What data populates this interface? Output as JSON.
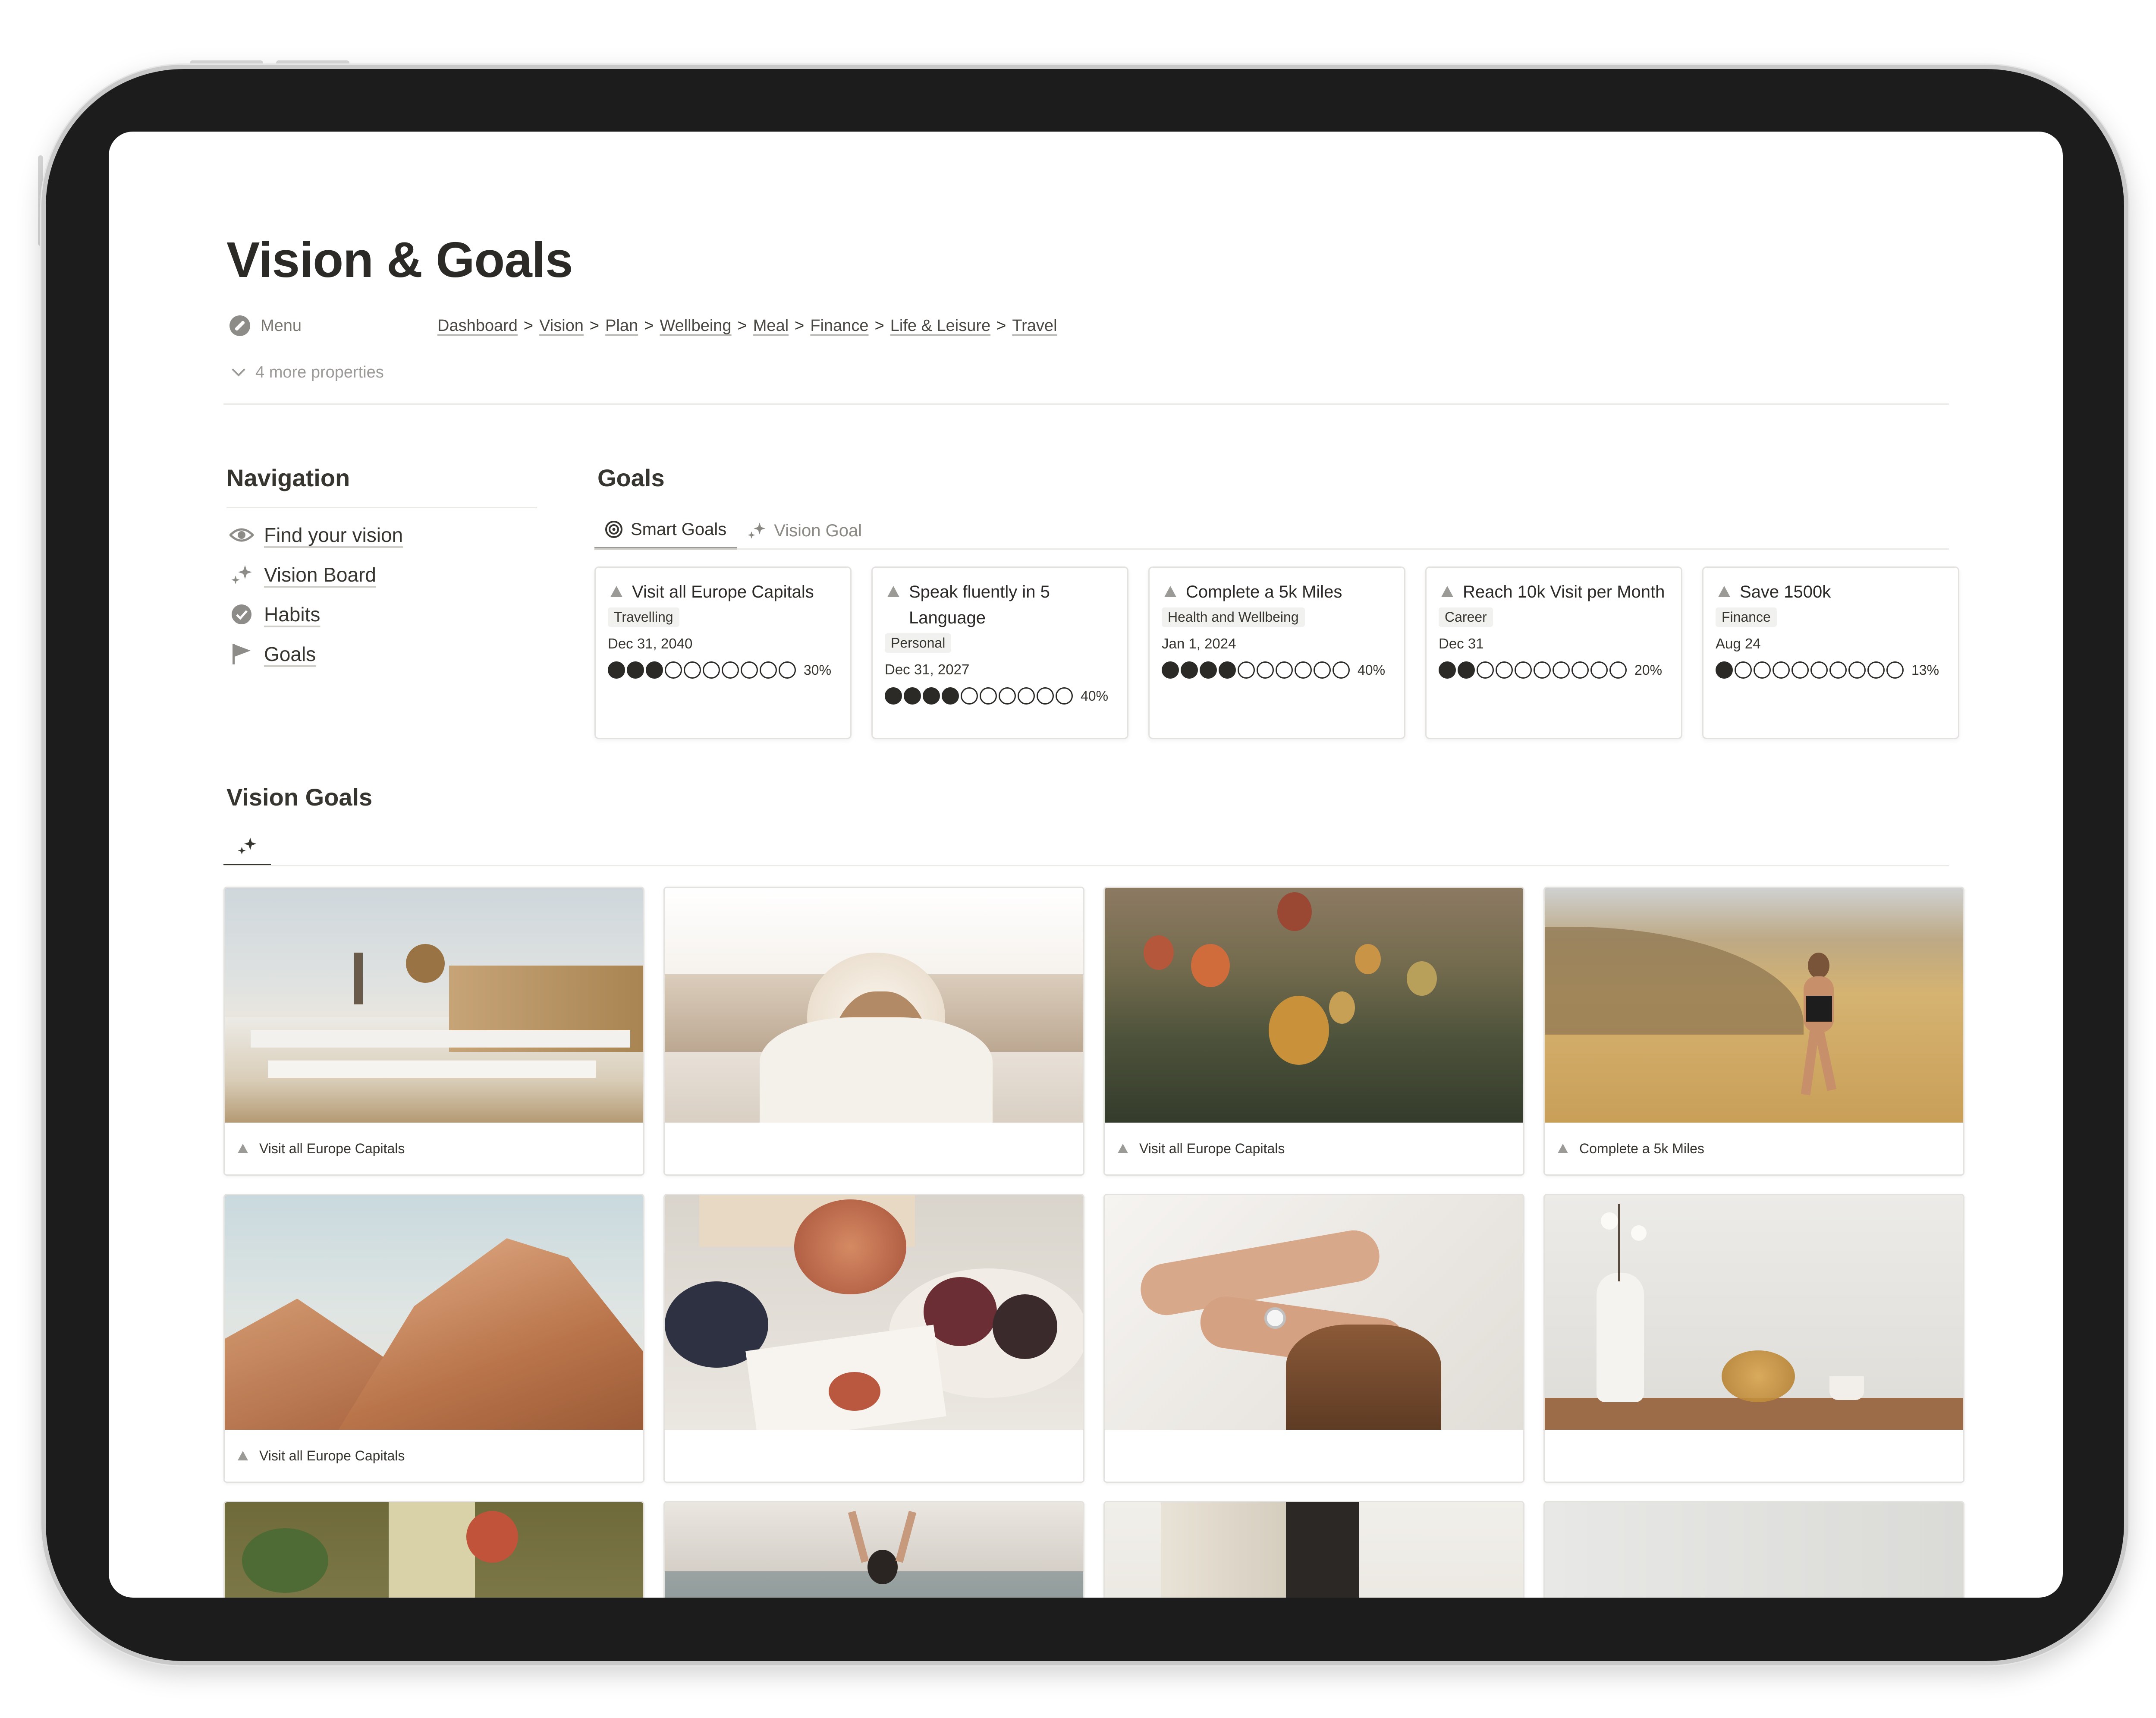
{
  "page": {
    "title": "Vision & Goals",
    "menu_label": "Menu",
    "breadcrumbs": [
      "Dashboard",
      "Vision",
      "Plan",
      "Wellbeing",
      "Meal",
      "Finance",
      "Life & Leisure",
      "Travel"
    ],
    "breadcrumb_separator": ">",
    "more_properties": "4 more properties"
  },
  "navigation": {
    "title": "Navigation",
    "items": [
      {
        "label": "Find your vision",
        "icon": "eye-icon"
      },
      {
        "label": "Vision Board",
        "icon": "sparkles-icon"
      },
      {
        "label": "Habits",
        "icon": "check-circle-icon"
      },
      {
        "label": "Goals",
        "icon": "flag-icon"
      }
    ]
  },
  "goals": {
    "title": "Goals",
    "tabs": [
      {
        "label": "Smart Goals",
        "icon": "target-icon",
        "active": true
      },
      {
        "label": "Vision Goal",
        "icon": "sparkles-icon",
        "active": false
      }
    ],
    "cards": [
      {
        "title": "Visit all Europe Capitals",
        "tag": "Travelling",
        "date": "Dec 31, 2040",
        "progress": 0.3,
        "filled": 3,
        "percent": "30%"
      },
      {
        "title": "Speak fluently in 5 Language",
        "tag": "Personal",
        "date": "Dec 31, 2027",
        "progress": 0.4,
        "filled": 4,
        "percent": "40%"
      },
      {
        "title": "Complete a 5k Miles",
        "tag": "Health and Wellbeing",
        "date": "Jan 1, 2024",
        "progress": 0.4,
        "filled": 4,
        "percent": "40%"
      },
      {
        "title": "Reach 10k Visit per Month",
        "tag": "Career",
        "date": "Dec 31",
        "progress": 0.2,
        "filled": 2,
        "percent": "20%"
      },
      {
        "title": "Save 1500k",
        "tag": "Finance",
        "date": "Aug 24",
        "progress": 0.13,
        "filled": 1,
        "percent": "13%"
      }
    ]
  },
  "vision_goals": {
    "title": "Vision Goals",
    "tab_icon": "sparkles-icon",
    "cards": [
      {
        "caption": "Visit all Europe Capitals",
        "image": "santorini-village"
      },
      {
        "caption": "",
        "image": "woman-sunlight-beach"
      },
      {
        "caption": "Visit all Europe Capitals",
        "image": "hot-air-balloons"
      },
      {
        "caption": "Complete a 5k Miles",
        "image": "woman-running-field"
      },
      {
        "caption": "Visit all Europe Capitals",
        "image": "sandstone-rocks"
      },
      {
        "caption": "",
        "image": "wine-and-figs"
      },
      {
        "caption": "",
        "image": "hands-with-rings"
      },
      {
        "caption": "",
        "image": "vase-and-teapot"
      },
      {
        "caption": "",
        "image": "greenhouse-plants"
      },
      {
        "caption": "",
        "image": "woman-in-sea"
      },
      {
        "caption": "",
        "image": "linen-blazer"
      },
      {
        "caption": "",
        "image": "grey-wall"
      }
    ]
  },
  "colors": {
    "text": "#37352f",
    "muted": "#9b9a97",
    "border": "#e3e2df",
    "tag_bg": "#f1f1ef",
    "device": "#1c1c1c"
  }
}
